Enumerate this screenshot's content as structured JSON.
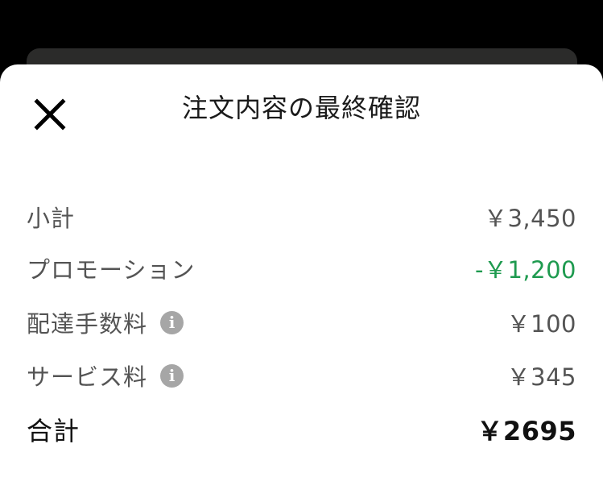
{
  "sheet": {
    "title": "注文内容の最終確認",
    "close_icon": "close-icon"
  },
  "summary": {
    "subtotal": {
      "label": "小計",
      "value": "￥3,450"
    },
    "promotion": {
      "label": "プロモーション",
      "value": "-￥1,200",
      "color": "#1e9a4f"
    },
    "delivery_fee": {
      "label": "配達手数料",
      "value": "￥100",
      "icon": "info-icon"
    },
    "service_fee": {
      "label": "サービス料",
      "value": "￥345",
      "icon": "info-icon"
    },
    "total": {
      "label": "合計",
      "value": "￥2695"
    }
  },
  "colors": {
    "background": "#000000",
    "sheet": "#ffffff",
    "backdrop_card": "#2b2b2a",
    "text_muted": "#545454",
    "text_strong": "#111111",
    "promo_green": "#1e9a4f",
    "info_icon": "#a6a6a6"
  }
}
